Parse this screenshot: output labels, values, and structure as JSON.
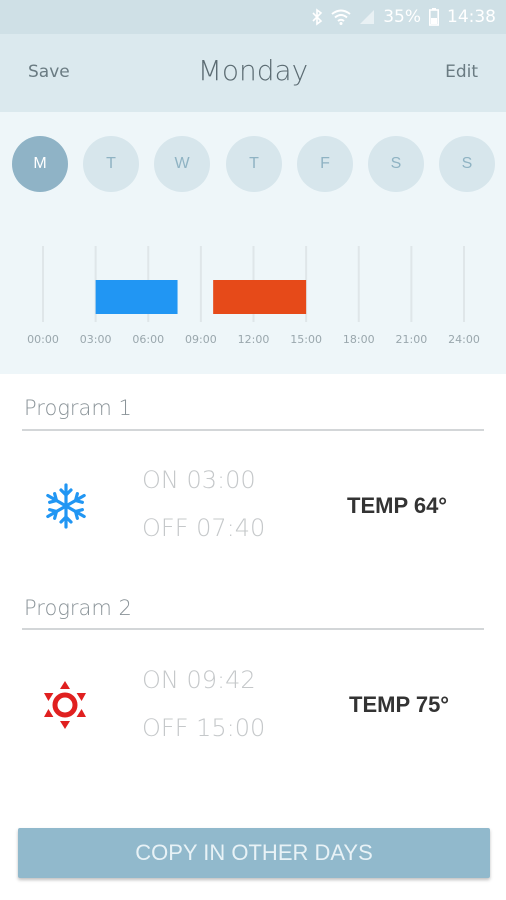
{
  "status": {
    "battery": "35%",
    "time": "14:38"
  },
  "header": {
    "save_label": "Save",
    "title": "Monday",
    "edit_label": "Edit"
  },
  "days": [
    "M",
    "T",
    "W",
    "T",
    "F",
    "S",
    "S"
  ],
  "schedule_chart": {
    "ticks": [
      "00:00",
      "03:00",
      "06:00",
      "09:00",
      "12:00",
      "15:00",
      "18:00",
      "21:00",
      "24:00"
    ],
    "blocks": [
      {
        "start_hour": 3.0,
        "end_hour": 7.67,
        "color": "#2196f3"
      },
      {
        "start_hour": 9.7,
        "end_hour": 15.0,
        "color": "#e64a19"
      }
    ]
  },
  "programs": [
    {
      "title": "Program 1",
      "icon": "snowflake-icon",
      "on": "ON 03:00",
      "off": "OFF 07:40",
      "temp": "TEMP 64°",
      "color": "#2196f3"
    },
    {
      "title": "Program 2",
      "icon": "sun-icon",
      "on": "ON 09:42",
      "off": "OFF 15:00",
      "temp": "TEMP 75°",
      "color": "#e02020"
    }
  ],
  "copy_button_label": "COPY IN OTHER DAYS"
}
